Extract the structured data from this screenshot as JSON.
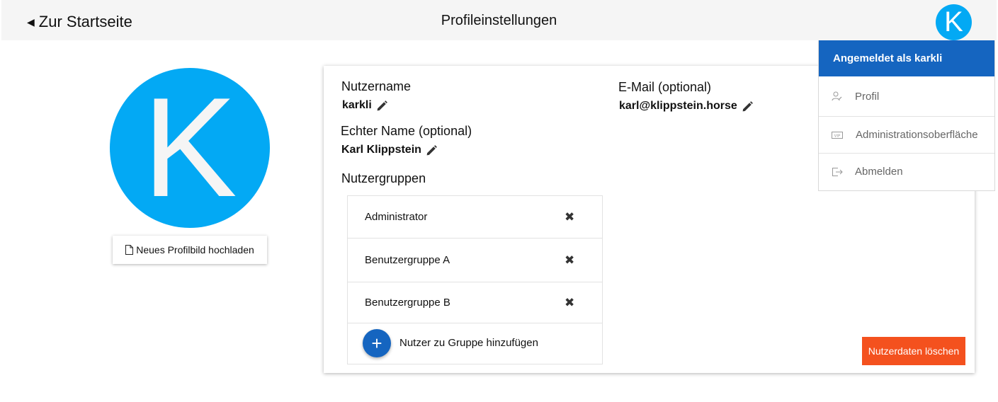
{
  "header": {
    "back_label": "Zur Startseite",
    "title": "Profileinstellungen",
    "avatar_letter": "K"
  },
  "profile": {
    "avatar_letter": "K",
    "upload_label": "Neues Profilbild hochladen"
  },
  "fields": {
    "username_label": "Nutzername",
    "username_value": "karkli",
    "realname_label": "Echter Name (optional)",
    "realname_value": "Karl Klippstein",
    "email_label": "E-Mail (optional)",
    "email_value": "karl@klippstein.horse"
  },
  "groups": {
    "title": "Nutzergruppen",
    "items": [
      {
        "name": "Administrator"
      },
      {
        "name": "Benutzergruppe A"
      },
      {
        "name": "Benutzergruppe B"
      }
    ],
    "add_label": "Nutzer zu Gruppe hinzufügen"
  },
  "actions": {
    "delete_label": "Nutzerdaten löschen"
  },
  "user_menu": {
    "header": "Angemeldet als karkli",
    "items": [
      {
        "label": "Profil",
        "icon": "user-edit-icon"
      },
      {
        "label": "Administrationsoberfläche",
        "icon": "vip-icon"
      },
      {
        "label": "Abmelden",
        "icon": "logout-icon"
      }
    ]
  },
  "colors": {
    "avatar": "#03a9f4",
    "primary": "#1565c0",
    "danger": "#f4511e"
  }
}
